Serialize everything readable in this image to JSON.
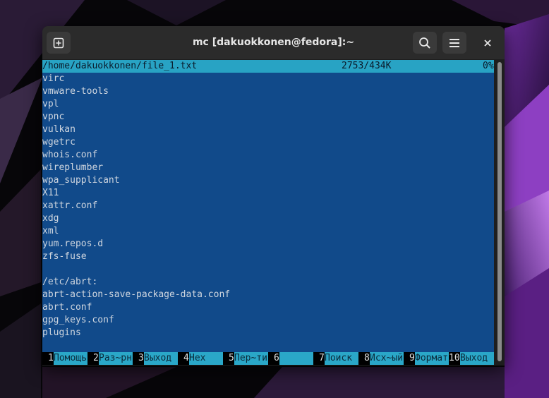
{
  "window": {
    "title": "mc [dakuokkonen@fedora]:~",
    "icons": {
      "new_tab": "new-tab-icon",
      "search": "search-icon",
      "menu": "hamburger-menu-icon",
      "close": "close-icon"
    }
  },
  "viewer": {
    "file_path": "/home/dakuokkonen/file_1.txt",
    "position": "2753/434K",
    "percent": "0%",
    "lines": [
      "virc",
      "vmware-tools",
      "vpl",
      "vpnc",
      "vulkan",
      "wgetrc",
      "whois.conf",
      "wireplumber",
      "wpa_supplicant",
      "X11",
      "xattr.conf",
      "xdg",
      "xml",
      "yum.repos.d",
      "zfs-fuse",
      "",
      "/etc/abrt:",
      "abrt-action-save-package-data.conf",
      "abrt.conf",
      "gpg_keys.conf",
      "plugins"
    ]
  },
  "fkeys": [
    {
      "num": "1",
      "label": "Помощь"
    },
    {
      "num": "2",
      "label": "Раз~рн"
    },
    {
      "num": "3",
      "label": "Выход"
    },
    {
      "num": "4",
      "label": "Hex"
    },
    {
      "num": "5",
      "label": "Пер~ти"
    },
    {
      "num": "6",
      "label": ""
    },
    {
      "num": "7",
      "label": "Поиск"
    },
    {
      "num": "8",
      "label": "Исх~ый"
    },
    {
      "num": "9",
      "label": "Формат"
    },
    {
      "num": "10",
      "label": "Выход"
    }
  ],
  "colors": {
    "viewer_bg": "#114a8a",
    "status_bg": "#28a3c4",
    "fkey_label_bg": "#2aa7c8",
    "titlebar_bg": "#2b2b2b"
  }
}
